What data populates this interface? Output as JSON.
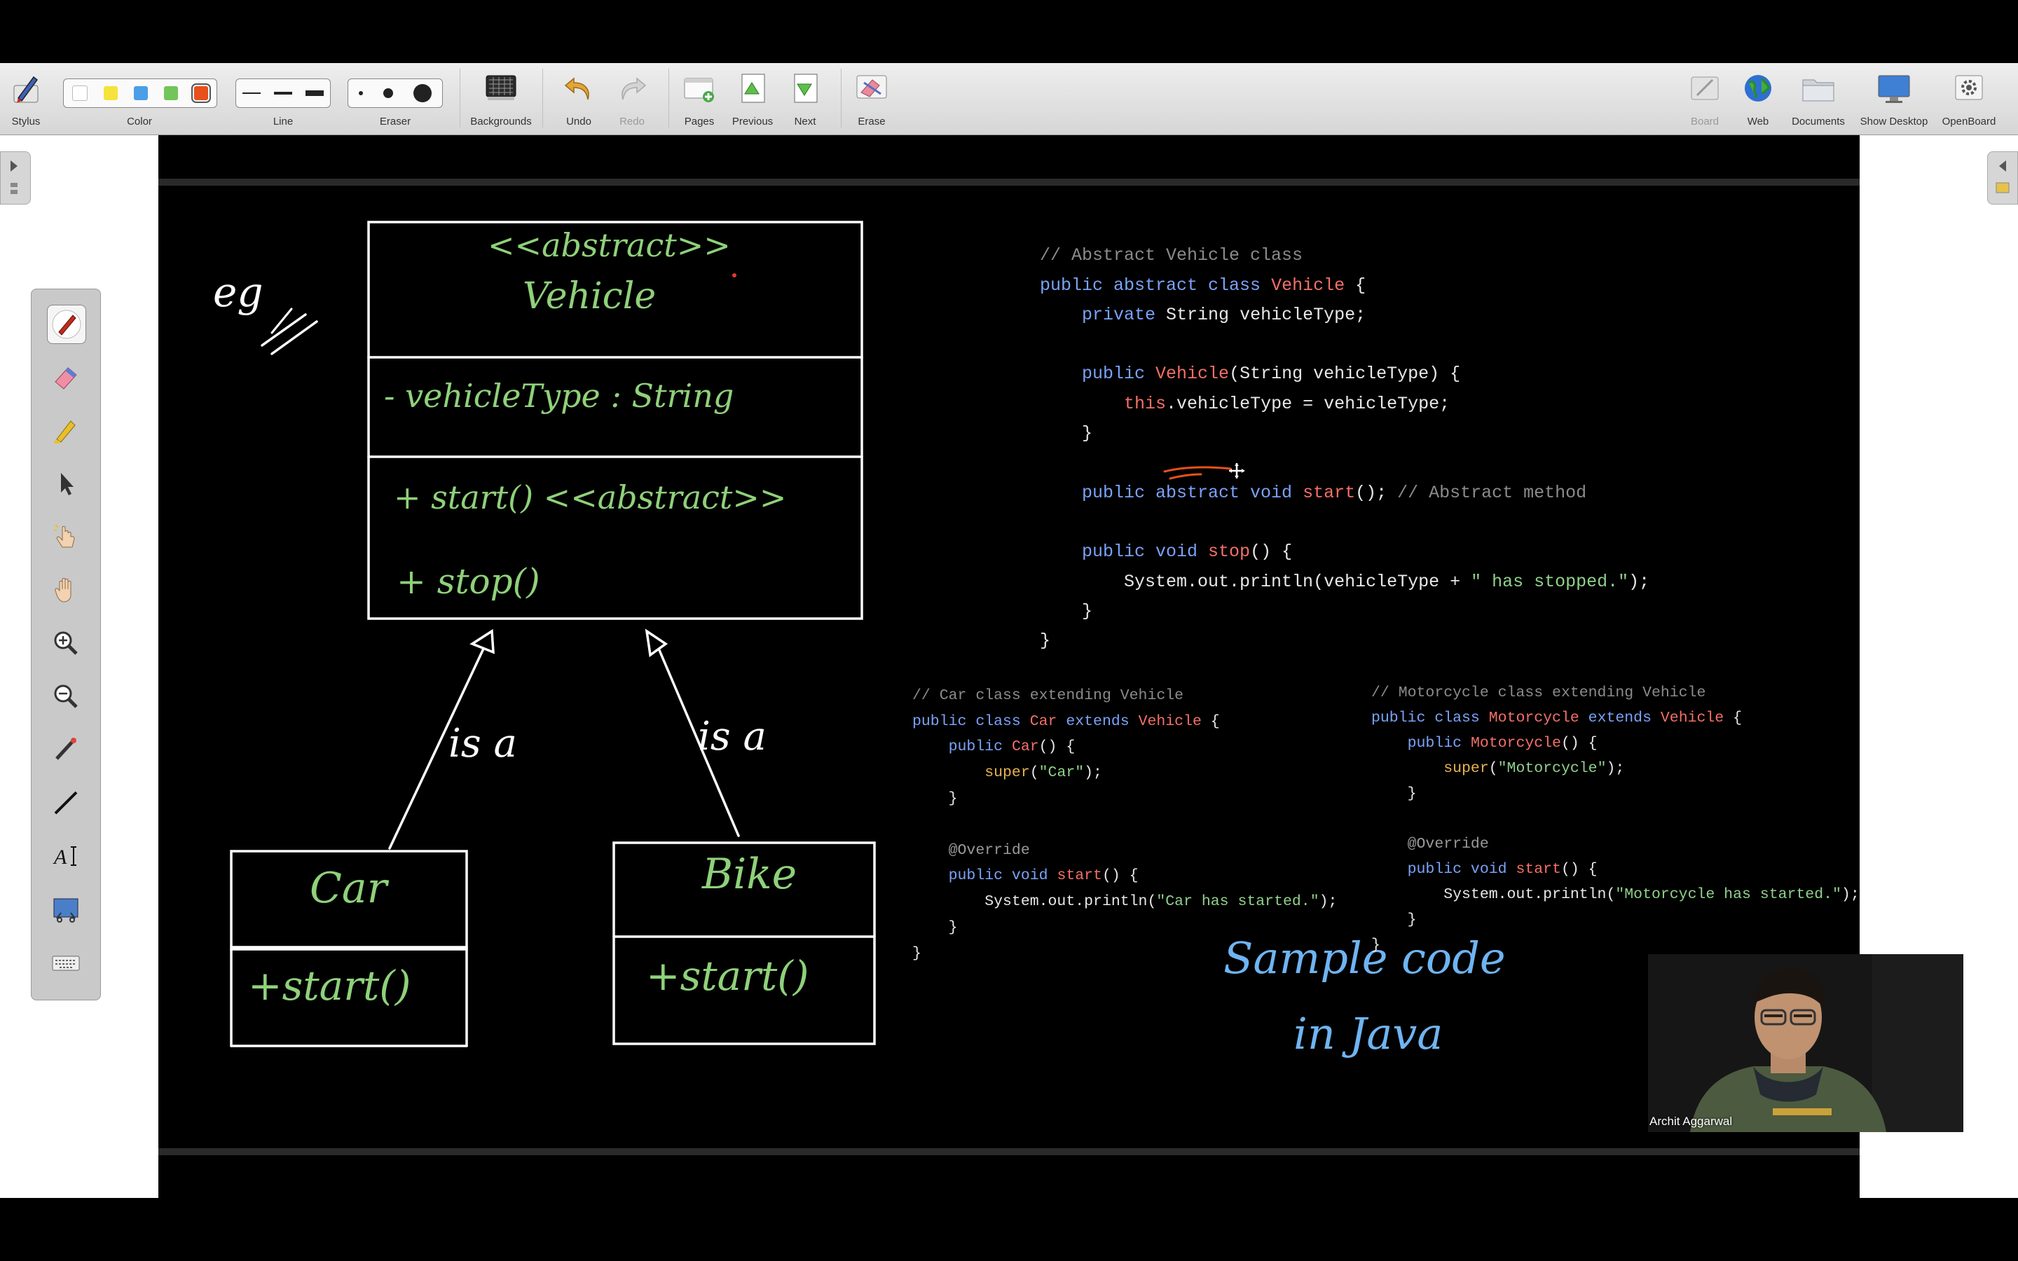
{
  "toolbar": {
    "left_tools": [
      {
        "label": "Stylus",
        "icon": "stylus-icon"
      },
      {
        "label": "Color",
        "icon": "color-swatches"
      },
      {
        "label": "Line",
        "icon": "line-width-icon"
      },
      {
        "label": "Eraser",
        "icon": "eraser-size-icon"
      },
      {
        "label": "Backgrounds",
        "icon": "backgrounds-icon"
      },
      {
        "label": "Undo",
        "icon": "undo-icon"
      },
      {
        "label": "Redo",
        "icon": "redo-icon"
      },
      {
        "label": "Pages",
        "icon": "pages-icon"
      },
      {
        "label": "Previous",
        "icon": "previous-page-icon"
      },
      {
        "label": "Next",
        "icon": "next-page-icon"
      },
      {
        "label": "Erase",
        "icon": "erase-page-icon"
      }
    ],
    "right_tools": [
      {
        "label": "Board",
        "icon": "board-icon"
      },
      {
        "label": "Web",
        "icon": "globe-icon"
      },
      {
        "label": "Documents",
        "icon": "folder-icon"
      },
      {
        "label": "Show Desktop",
        "icon": "monitor-icon"
      },
      {
        "label": "OpenBoard",
        "icon": "gear-icon"
      }
    ],
    "colors": [
      "#ffffff",
      "#f5e33b",
      "#4a9ee8",
      "#72c55a",
      "#e8501c"
    ],
    "selected_color": "#e8501c"
  },
  "palette": {
    "tools": [
      "pen-icon",
      "eraser-icon",
      "highlighter-icon",
      "select-arrow-icon",
      "interact-pointer-icon",
      "hand-icon",
      "zoom-in-icon",
      "zoom-out-icon",
      "laser-pointer-icon",
      "line-tool-icon",
      "text-tool-icon",
      "capture-icon",
      "keyboard-icon"
    ],
    "active": "pen-icon"
  },
  "diagram": {
    "eg_label": "eg",
    "abstract_class": {
      "stereotype": "<<abstract>>",
      "name": "Vehicle",
      "attribute": "- vehicleType : String",
      "methods": [
        "+ start() <<abstract>>",
        "+ stop()"
      ]
    },
    "relation_label_left": "is a",
    "relation_label_right": "is a",
    "subclasses": [
      {
        "name": "Car",
        "method": "+start()"
      },
      {
        "name": "Bike",
        "method": "+start()"
      }
    ],
    "note": [
      "Sample code",
      "in Java"
    ]
  },
  "code_main": [
    "// Abstract Vehicle class",
    "public abstract class Vehicle {",
    "    private String vehicleType;",
    "",
    "    public Vehicle(String vehicleType) {",
    "        this.vehicleType = vehicleType;",
    "    }",
    "",
    "    public abstract void start(); // Abstract method",
    "",
    "    public void stop() {",
    "        System.out.println(vehicleType + \" has stopped.\");",
    "    }",
    "}"
  ],
  "code_car": [
    "// Car class extending Vehicle",
    "public class Car extends Vehicle {",
    "    public Car() {",
    "        super(\"Car\");",
    "    }",
    "",
    "    @Override",
    "    public void start() {",
    "        System.out.println(\"Car has started.\");",
    "    }",
    "}"
  ],
  "code_moto": [
    "// Motorcycle class extending Vehicle",
    "public class Motorcycle extends Vehicle {",
    "    public Motorcycle() {",
    "        super(\"Motorcycle\");",
    "    }",
    "",
    "    @Override",
    "    public void start() {",
    "        System.out.println(\"Motorcycle has started.\");",
    "    }",
    "}"
  ],
  "webcam": {
    "name": "Archit Aggarwal"
  }
}
